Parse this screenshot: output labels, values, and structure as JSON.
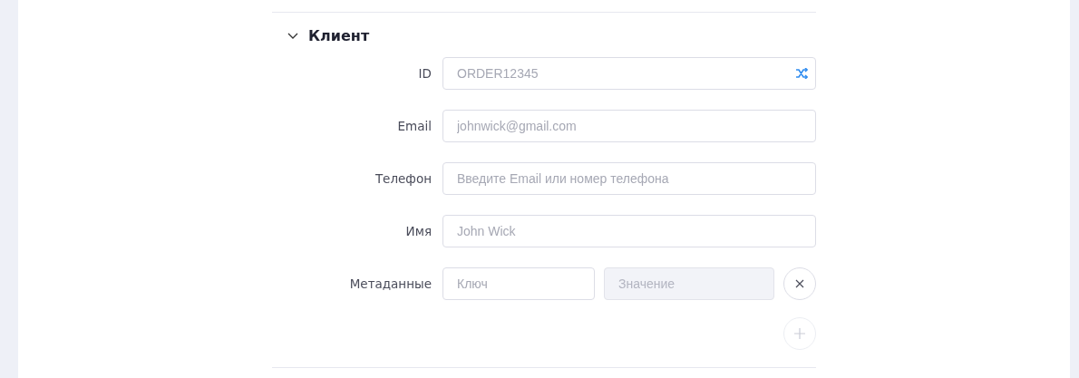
{
  "section": {
    "title": "Клиент",
    "expanded": true
  },
  "fields": [
    {
      "kind": "generate",
      "label": "ID",
      "placeholder": "ORDER12345"
    },
    {
      "kind": "text",
      "label": "Email",
      "placeholder": "johnwick@gmail.com"
    },
    {
      "kind": "text",
      "label": "Телефон",
      "placeholder": "Введите Email или номер телефона"
    },
    {
      "kind": "text",
      "label": "Имя",
      "placeholder": "John Wick"
    },
    {
      "kind": "pair",
      "label": "Метаданные",
      "key_placeholder": "Ключ",
      "value_placeholder": "Значение",
      "value_disabled": true
    }
  ],
  "add_button": {
    "disabled": true
  }
}
